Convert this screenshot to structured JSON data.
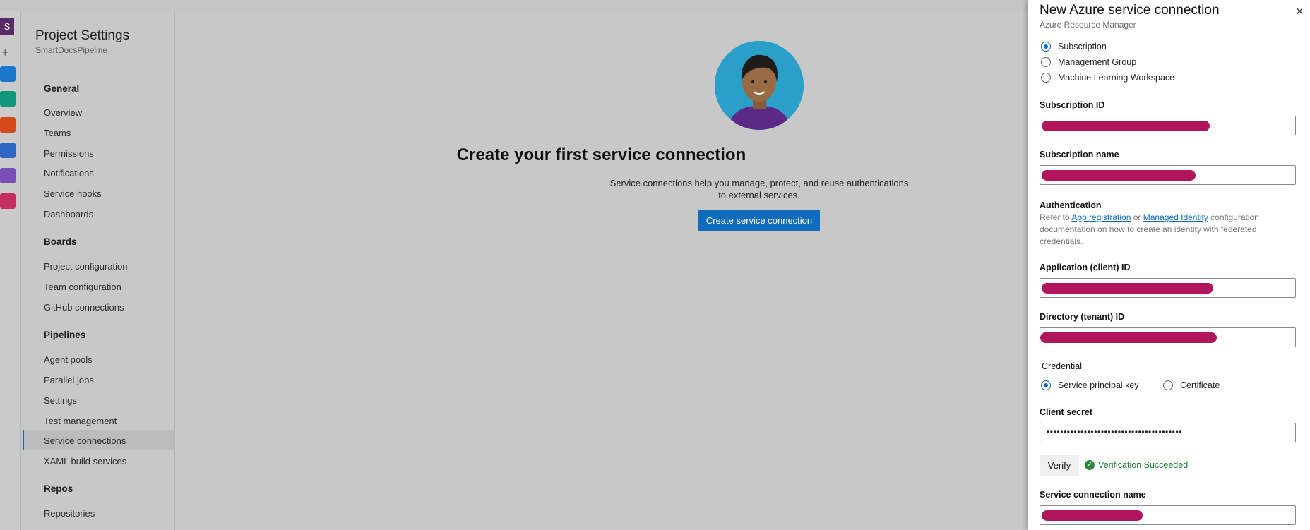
{
  "topbar": {
    "breadcrumb": ""
  },
  "rail": {
    "org_initial": "S"
  },
  "nav": {
    "title": "Project Settings",
    "project": "SmartDocsPipeline",
    "sections": {
      "general": "General",
      "boards": "Boards",
      "pipelines": "Pipelines",
      "repos": "Repos"
    },
    "general_items": [
      "Overview",
      "Teams",
      "Permissions",
      "Notifications",
      "Service hooks",
      "Dashboards"
    ],
    "boards_items": [
      "Project configuration",
      "Team configuration",
      "GitHub connections"
    ],
    "pipelines_items": [
      "Agent pools",
      "Parallel jobs",
      "Settings",
      "Test management",
      "Service connections",
      "XAML build services"
    ],
    "repos_items": [
      "Repositories"
    ],
    "active_item": "Service connections"
  },
  "empty_state": {
    "headline": "Create your first service connection",
    "description": "Service connections help you manage, protect, and reuse authentications to external services.",
    "button": "Create service connection"
  },
  "panel": {
    "title": "New Azure service connection",
    "subtitle": "Azure Resource Manager",
    "close_icon": "×",
    "scope_options": [
      "Subscription",
      "Management Group",
      "Machine Learning Workspace"
    ],
    "scope_selected": "Subscription",
    "subscription_id_label": "Subscription ID",
    "subscription_name_label": "Subscription name",
    "auth_heading": "Authentication",
    "auth_text_prefix": "Refer to ",
    "auth_link1": "App registration",
    "auth_text_mid": " or ",
    "auth_link2": "Managed Identity",
    "auth_text_suffix": " configuration documentation on how to create an identity with federated credentials.",
    "app_id_label": "Application (client) ID",
    "tenant_id_label": "Directory (tenant) ID",
    "credential_label": "Credential",
    "credential_options": [
      "Service principal key",
      "Certificate"
    ],
    "credential_selected": "Service principal key",
    "client_secret_label": "Client secret",
    "client_secret_value": "••••••••••••••••••••••••••••••••••••••••",
    "verify_button": "Verify",
    "verify_status": "Verification Succeeded",
    "connection_name_label": "Service connection name"
  },
  "colors": {
    "accent": "#0f6cbd",
    "redaction": "#b0145a",
    "success": "#1e7b34"
  }
}
